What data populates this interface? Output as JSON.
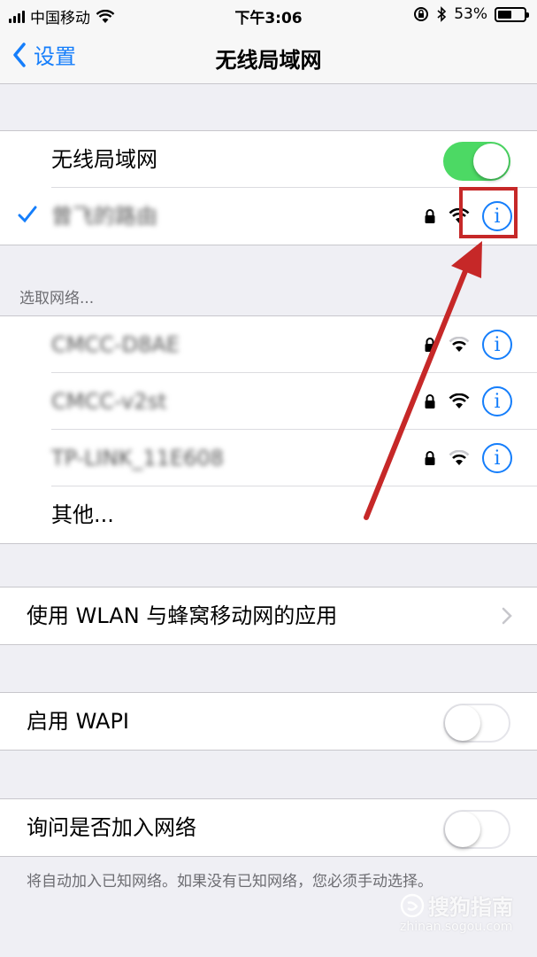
{
  "status_bar": {
    "carrier": "中国移动",
    "time": "下午3:06",
    "battery_percent": "53%",
    "battery_level": 0.53,
    "icons": [
      "signal-icon",
      "wifi-icon",
      "orientation-lock-icon",
      "bluetooth-icon",
      "battery-icon"
    ]
  },
  "nav": {
    "back_label": "设置",
    "title": "无线局域网"
  },
  "wifi_toggle": {
    "label": "无线局域网",
    "on": true
  },
  "connected_network": {
    "name": "曾飞的路由",
    "locked": true,
    "selected": true
  },
  "choose_network_header": "选取网络...",
  "networks": [
    {
      "name": "CMCC-D8AE",
      "locked": true
    },
    {
      "name": "CMCC-v2st",
      "locked": true
    },
    {
      "name": "TP-LINK_11E608",
      "locked": true
    }
  ],
  "other_label": "其他...",
  "wlan_apps_label": "使用 WLAN 与蜂窝移动网的应用",
  "wapi": {
    "label": "启用 WAPI",
    "on": false
  },
  "ask_join": {
    "label": "询问是否加入网络",
    "on": false
  },
  "footer_note": "将自动加入已知网络。如果没有已知网络，您必须手动选择。",
  "watermark": {
    "text": "搜狗指南",
    "sub": "zhinan.sogou.com"
  },
  "colors": {
    "accent": "#157efb",
    "toggle_on": "#4cd964",
    "annotation": "#c62828",
    "background": "#efeff4"
  }
}
